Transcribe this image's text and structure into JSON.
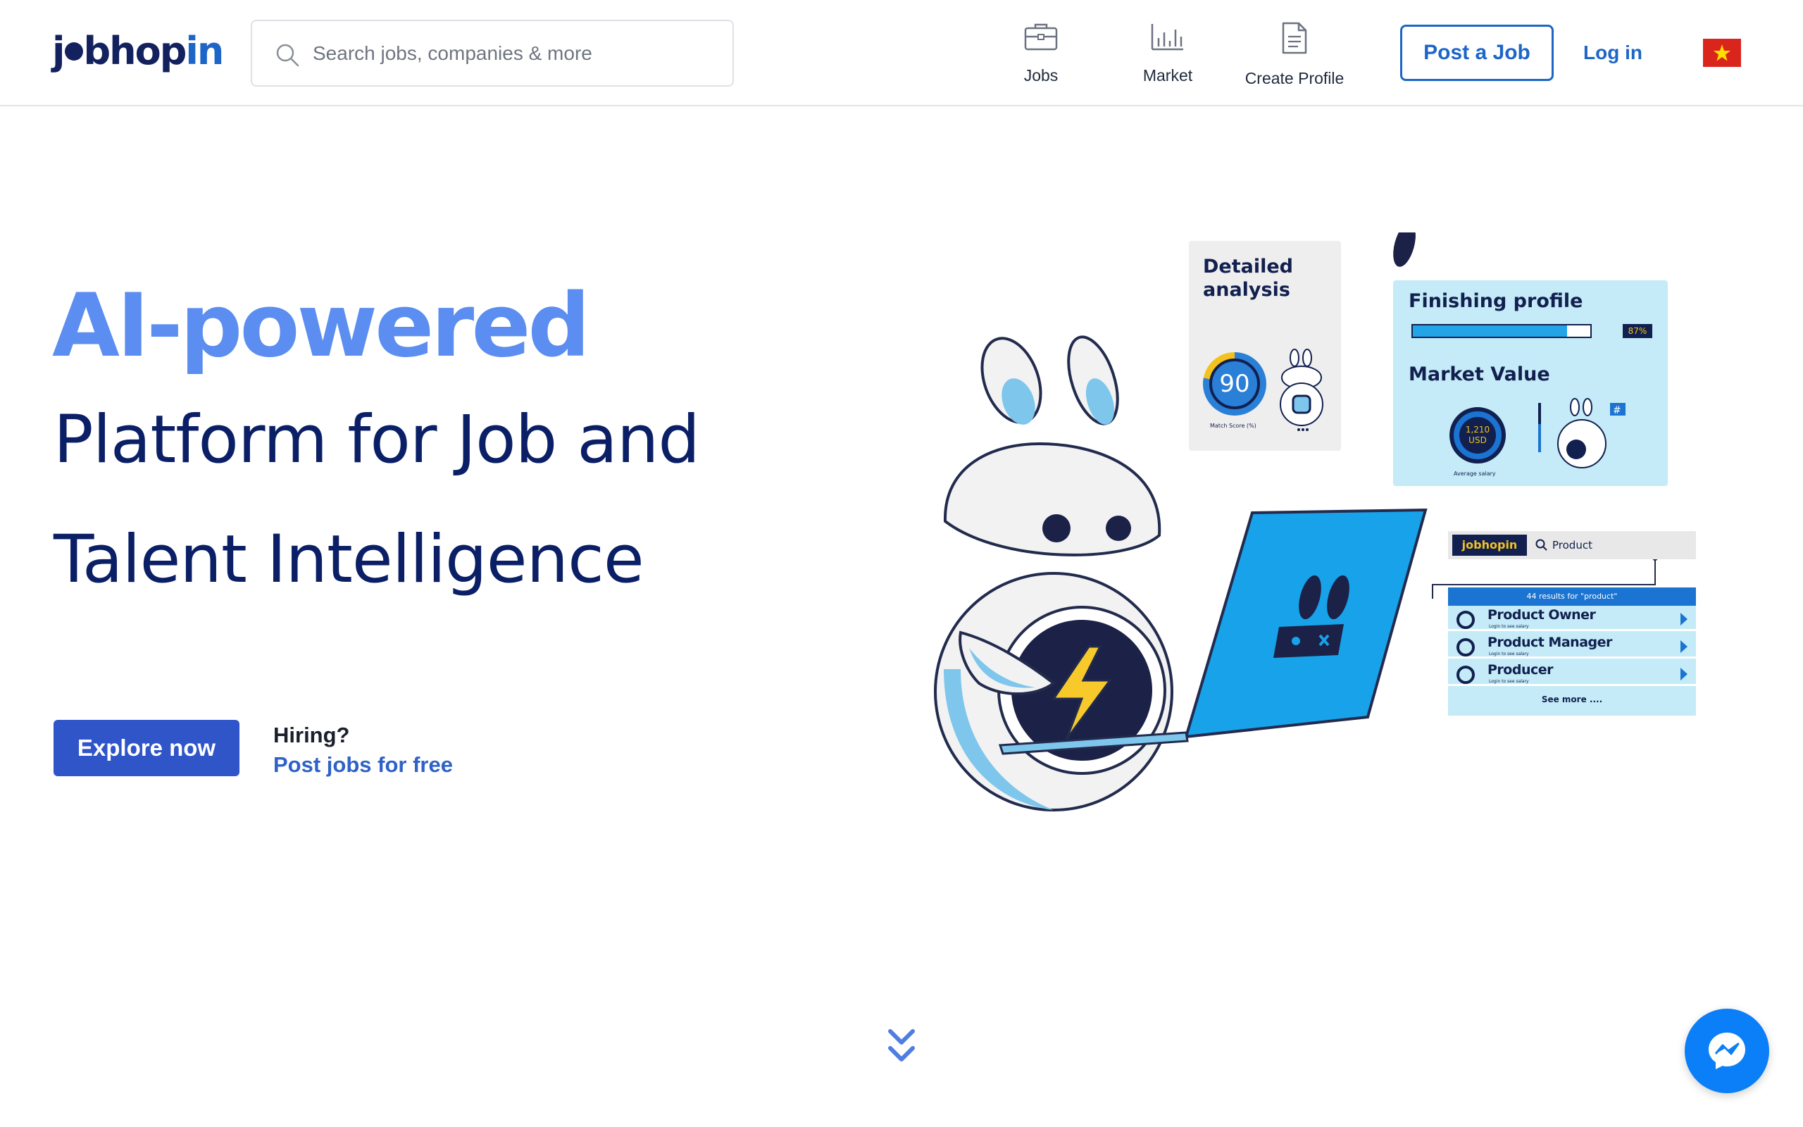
{
  "header": {
    "logo": {
      "part1": "j",
      "part2": "bhop",
      "part3": "in"
    },
    "search": {
      "placeholder": "Search jobs, companies & more"
    },
    "nav": [
      {
        "label": "Jobs",
        "icon": "briefcase-icon"
      },
      {
        "label": "Market",
        "icon": "bar-chart-icon"
      },
      {
        "label": "Create Profile",
        "icon": "document-icon"
      }
    ],
    "post_job_label": "Post a Job",
    "login_label": "Log in",
    "language_flag": "vietnam-flag-icon"
  },
  "hero": {
    "kicker": "AI-powered",
    "line1": "Platform for Job and",
    "line2": "Talent Intelligence",
    "explore_label": "Explore now",
    "hiring_label": "Hiring?",
    "post_free_label": "Post jobs for free"
  },
  "illustration": {
    "analysis_card": {
      "title": "Detailed analysis",
      "score": "90",
      "score_caption": "Match Score (%)"
    },
    "profile_card": {
      "finishing_title": "Finishing profile",
      "progress_percent": 87,
      "progress_label": "87%",
      "market_title": "Market Value",
      "salary_value": "1,210",
      "salary_unit": "USD",
      "salary_caption": "Average salary"
    },
    "search_card": {
      "logo": "jobhopin",
      "query": "Product",
      "results_summary": "44 results for \"product\"",
      "results": [
        {
          "title": "Product Owner",
          "subtitle": "Login to see salary"
        },
        {
          "title": "Product Manager",
          "subtitle": "Login to see salary"
        },
        {
          "title": "Producer",
          "subtitle": "Login to see salary"
        }
      ],
      "see_more": "See more ...."
    }
  },
  "colors": {
    "brand_navy": "#0b1f66",
    "brand_blue": "#1d66c8",
    "accent_light_blue": "#5b8ef0",
    "button_blue": "#2f55c9",
    "messenger_blue": "#0b7ff7"
  },
  "icons": {
    "scroll_down": "double-chevron-down-icon",
    "messenger": "messenger-icon"
  }
}
